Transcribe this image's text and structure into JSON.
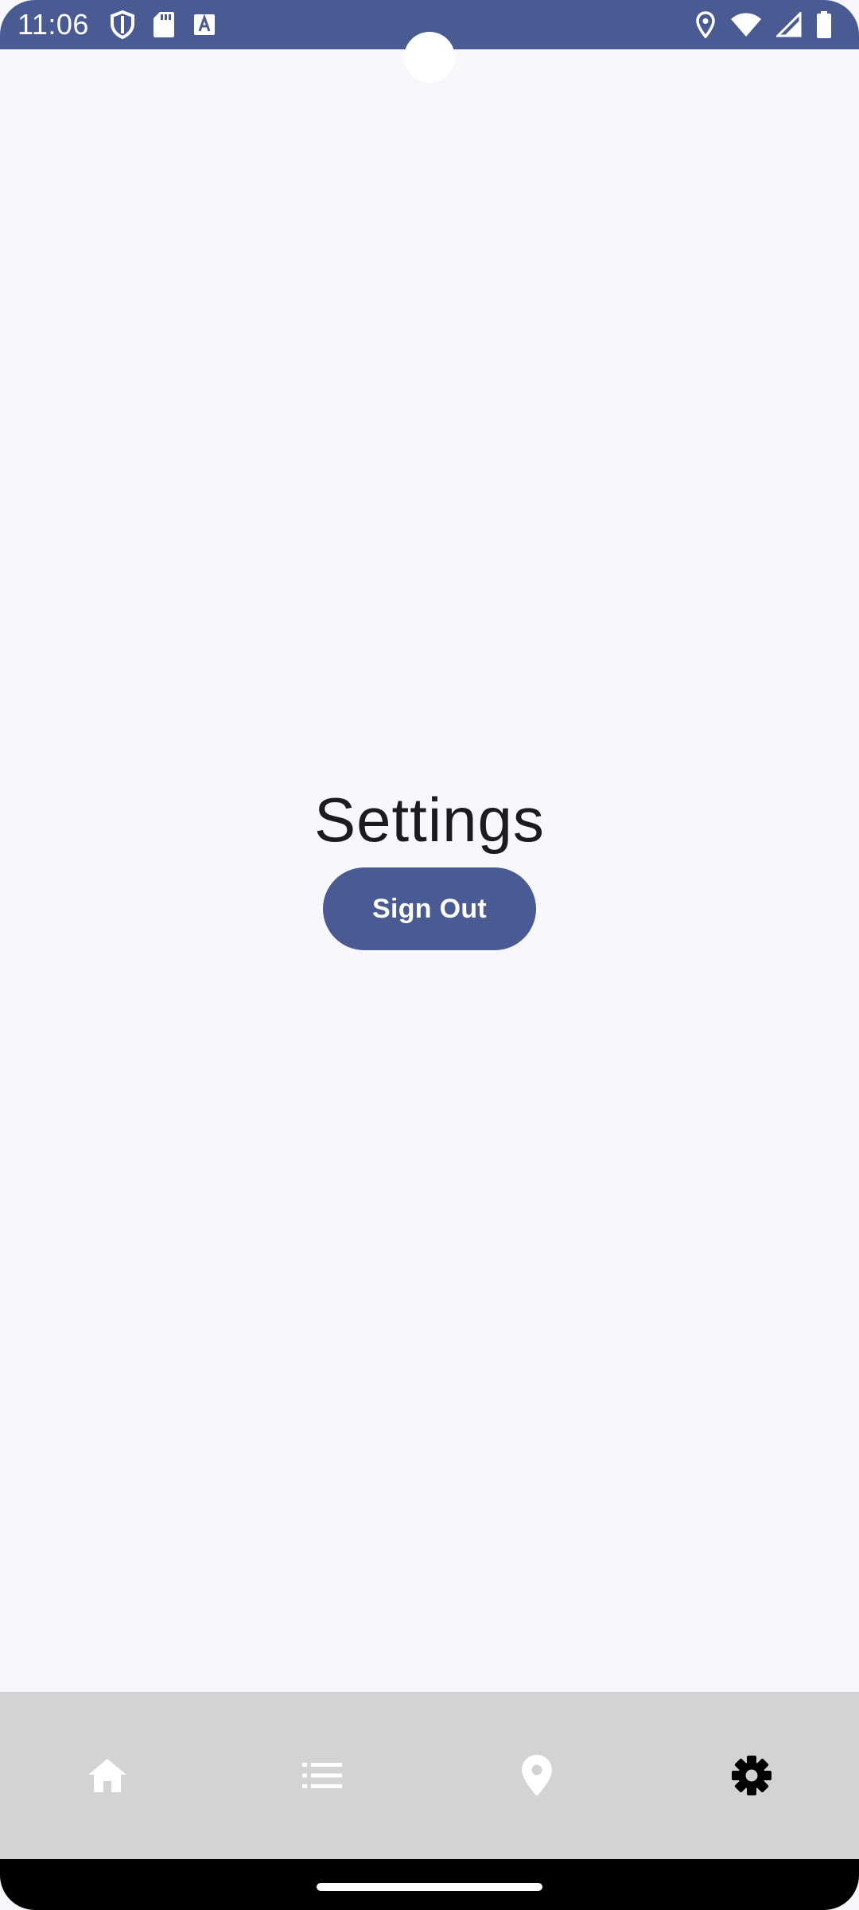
{
  "status_bar": {
    "time": "11:06",
    "color": "#4a5b93",
    "left_icons": [
      "shield-icon",
      "sd-card-icon",
      "font-a-icon"
    ],
    "right_icons": [
      "location-icon",
      "wifi-icon",
      "signal-icon",
      "battery-icon"
    ]
  },
  "main": {
    "title": "Settings",
    "sign_out_label": "Sign Out",
    "button_color": "#4a5b93",
    "background": "#f7f7fc"
  },
  "bottom_nav": {
    "background": "#d3d3d3",
    "items": [
      {
        "icon": "home-icon",
        "selected": false
      },
      {
        "icon": "list-icon",
        "selected": false
      },
      {
        "icon": "map-pin-icon",
        "selected": false
      },
      {
        "icon": "gear-icon",
        "selected": true
      }
    ]
  }
}
